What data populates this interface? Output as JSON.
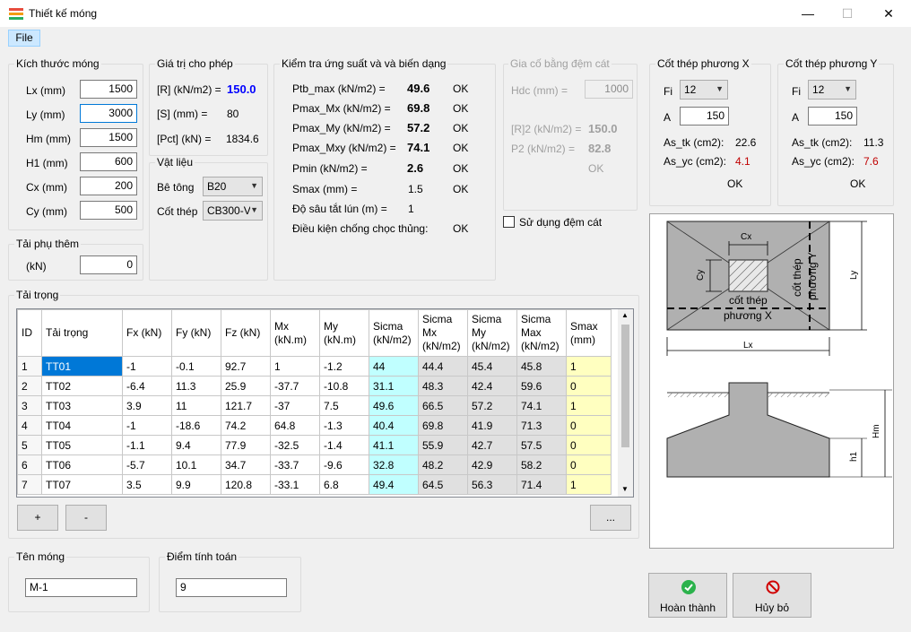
{
  "window": {
    "title": "Thiết kế móng",
    "min": "—",
    "max": "☐",
    "close": "✕"
  },
  "menu": {
    "file": "File"
  },
  "kich_thuoc": {
    "title": "Kích thước móng",
    "fields": [
      {
        "label": "Lx (mm)",
        "value": "1500"
      },
      {
        "label": "Ly (mm)",
        "value": "3000"
      },
      {
        "label": "Hm (mm)",
        "value": "1500"
      },
      {
        "label": "H1 (mm)",
        "value": "600"
      },
      {
        "label": "Cx (mm)",
        "value": "200"
      },
      {
        "label": "Cy (mm)",
        "value": "500"
      }
    ]
  },
  "tai_phu": {
    "title": "Tải phụ thêm",
    "label": "(kN)",
    "value": "0"
  },
  "gia_tri": {
    "title": "Giá trị cho phép",
    "r_label": "[R] (kN/m2) =",
    "r_value": "150.0",
    "s_label": "[S] (mm) =",
    "s_value": "80",
    "pct_label": "[Pct] (kN) =",
    "pct_value": "1834.6"
  },
  "vat_lieu": {
    "title": "Vật liệu",
    "betong_label": "Bê tông",
    "betong_value": "B20",
    "cotthep_label": "Cốt thép",
    "cotthep_value": "CB300-V"
  },
  "kiem_tra": {
    "title": "Kiểm tra ứng suất và và biến dạng",
    "rows": [
      {
        "label": "Ptb_max (kN/m2) =",
        "value": "49.6",
        "status": "OK"
      },
      {
        "label": "Pmax_Mx (kN/m2) =",
        "value": "69.8",
        "status": "OK"
      },
      {
        "label": "Pmax_My (kN/m2) =",
        "value": "57.2",
        "status": "OK"
      },
      {
        "label": "Pmax_Mxy (kN/m2) =",
        "value": "74.1",
        "status": "OK"
      },
      {
        "label": "Pmin (kN/m2) =",
        "value": "2.6",
        "status": "OK"
      }
    ],
    "smax_label": "Smax (mm) =",
    "smax_value": "1.5",
    "smax_status": "OK",
    "dosau_label": "Độ sâu tắt lún (m) =",
    "dosau_value": "1",
    "dieukien_label": "Điều kiện chống chọc thủng:",
    "dieukien_status": "OK"
  },
  "gia_co": {
    "title": "Gia cố bằng đệm cát",
    "hdc_label": "Hdc (mm) =",
    "hdc_value": "1000",
    "r2_label": "[R]2 (kN/m2) =",
    "r2_value": "150.0",
    "p2_label": "P2 (kN/m2) =",
    "p2_value": "82.8",
    "status": "OK",
    "checkbox_label": "Sử dụng đệm cát"
  },
  "cot_thep_x": {
    "title": "Cốt thép phương X",
    "fi_label": "Fi",
    "fi_value": "12",
    "a_label": "A",
    "a_value": "150",
    "astk_label": "As_tk (cm2):",
    "astk_value": "22.6",
    "asyc_label": "As_yc (cm2):",
    "asyc_value": "4.1",
    "status": "OK"
  },
  "cot_thep_y": {
    "title": "Cốt thép phương Y",
    "fi_label": "Fi",
    "fi_value": "12",
    "a_label": "A",
    "a_value": "150",
    "astk_label": "As_tk (cm2):",
    "astk_value": "11.3",
    "asyc_label": "As_yc (cm2):",
    "asyc_value": "7.6",
    "status": "OK"
  },
  "drawing": {
    "cx": "Cx",
    "cy": "Cy",
    "lx": "Lx",
    "ly": "Ly",
    "hm": "Hm",
    "h1": "h1",
    "cot_thep_x": "cốt thép\nphương X",
    "cot_thep_y": "cốt thép\nphương Y"
  },
  "tai_trong": {
    "title": "Tải trọng",
    "headers": [
      "ID",
      "Tải trọng",
      "Fx (kN)",
      "Fy (kN)",
      "Fz (kN)",
      "Mx (kN.m)",
      "My (kN.m)",
      "Sicma (kN/m2)",
      "Sicma Mx (kN/m2)",
      "Sicma My (kN/m2)",
      "Sicma Max (kN/m2)",
      "Smax (mm)"
    ],
    "rows": [
      [
        "1",
        "TT01",
        "-1",
        "-0.1",
        "92.7",
        "1",
        "-1.2",
        "44",
        "44.4",
        "45.4",
        "45.8",
        "1"
      ],
      [
        "2",
        "TT02",
        "-6.4",
        "11.3",
        "25.9",
        "-37.7",
        "-10.8",
        "31.1",
        "48.3",
        "42.4",
        "59.6",
        "0"
      ],
      [
        "3",
        "TT03",
        "3.9",
        "11",
        "121.7",
        "-37",
        "7.5",
        "49.6",
        "66.5",
        "57.2",
        "74.1",
        "1"
      ],
      [
        "4",
        "TT04",
        "-1",
        "-18.6",
        "74.2",
        "64.8",
        "-1.3",
        "40.4",
        "69.8",
        "41.9",
        "71.3",
        "0"
      ],
      [
        "5",
        "TT05",
        "-1.1",
        "9.4",
        "77.9",
        "-32.5",
        "-1.4",
        "41.1",
        "55.9",
        "42.7",
        "57.5",
        "0"
      ],
      [
        "6",
        "TT06",
        "-5.7",
        "10.1",
        "34.7",
        "-33.7",
        "-9.6",
        "32.8",
        "48.2",
        "42.9",
        "58.2",
        "0"
      ],
      [
        "7",
        "TT07",
        "3.5",
        "9.9",
        "120.8",
        "-33.1",
        "6.8",
        "49.4",
        "64.5",
        "56.3",
        "71.4",
        "1"
      ]
    ],
    "add_button": "+",
    "remove_button": "-",
    "more_button": "..."
  },
  "ten_mong": {
    "title": "Tên móng",
    "value": "M-1"
  },
  "diem_tinh": {
    "title": "Điểm tính toán",
    "value": "9"
  },
  "actions": {
    "ok": "Hoàn thành",
    "cancel": "Hủy bỏ"
  },
  "colors": {
    "ok_green": "#2bb24c",
    "cancel_red": "#d00000",
    "accent": "#0078d7"
  }
}
